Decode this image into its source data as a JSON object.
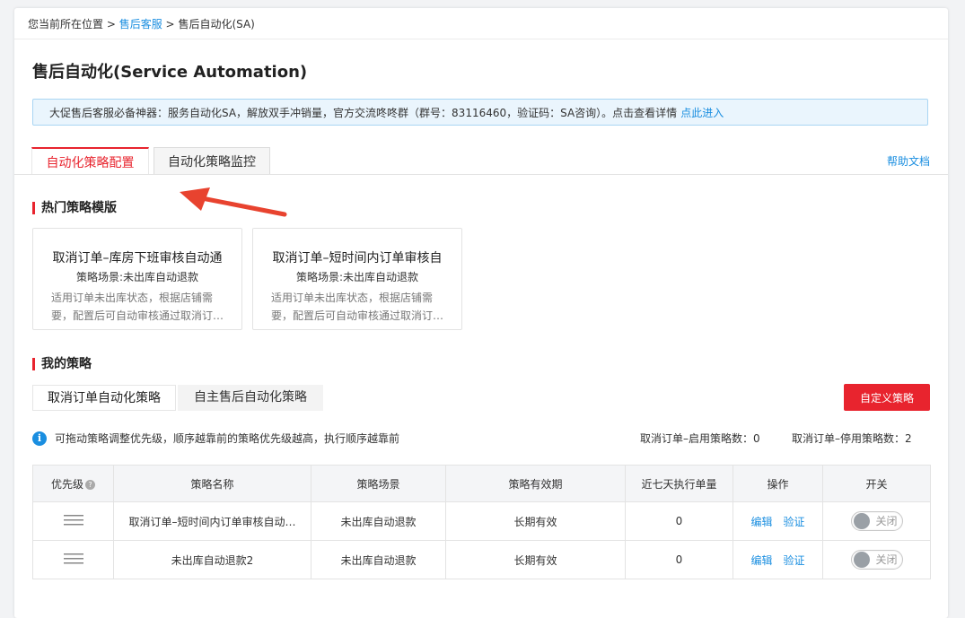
{
  "breadcrumb": {
    "prefix": "您当前所在位置 >",
    "link": "售后客服",
    "sep": ">",
    "current": "售后自动化(SA)"
  },
  "page_title": "售后自动化(Service Automation)",
  "notice": {
    "text": "大促售后客服必备神器：服务自动化SA，解放双手冲销量，官方交流咚咚群（群号：83116460，验证码：SA咨询）。点击查看详情",
    "link": "点此进入"
  },
  "tabs": [
    "自动化策略配置",
    "自动化策略监控"
  ],
  "help_link": "帮助文档",
  "hot_section_title": "热门策略模版",
  "templates": [
    {
      "title": "取消订单–库房下班审核自动通",
      "scene": "策略场景:未出库自动退款",
      "desc1": "适用订单未出库状态，根据店铺需",
      "desc2": "要，配置后可自动审核通过取消订…"
    },
    {
      "title": "取消订单–短时间内订单审核自",
      "scene": "策略场景:未出库自动退款",
      "desc1": "适用订单未出库状态，根据店铺需",
      "desc2": "要，配置后可自动审核通过取消订…"
    }
  ],
  "my_section_title": "我的策略",
  "subtabs": [
    "取消订单自动化策略",
    "自主售后自动化策略"
  ],
  "custom_button": "自定义策略",
  "info_text": "可拖动策略调整优先级，顺序越靠前的策略优先级越高，执行顺序越靠前",
  "stats": {
    "enabled": "取消订单–启用策略数：0",
    "disabled": "取消订单–停用策略数：2"
  },
  "table": {
    "headers": [
      "优先级",
      "策略名称",
      "策略场景",
      "策略有效期",
      "近七天执行单量",
      "操作",
      "开关"
    ],
    "rows": [
      {
        "name": "取消订单–短时间内订单审核自动…",
        "scene": "未出库自动退款",
        "validity": "长期有效",
        "count": "0",
        "edit": "编辑",
        "verify": "验证",
        "switch": "关闭"
      },
      {
        "name": "未出库自动退款2",
        "scene": "未出库自动退款",
        "validity": "长期有效",
        "count": "0",
        "edit": "编辑",
        "verify": "验证",
        "switch": "关闭"
      }
    ]
  },
  "colors": {
    "accent_red": "#e8242e",
    "link_blue": "#1a8ee0"
  }
}
